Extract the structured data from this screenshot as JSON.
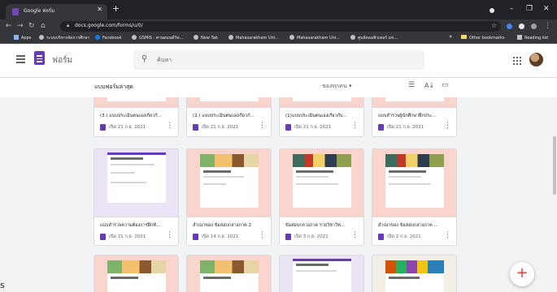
{
  "browser": {
    "tab_title": "Google ฟอร์ม",
    "url": "docs.google.com/forms/u/0/",
    "bookmarks": [
      "Apps",
      "ระบบบริหารจัดการศึกษา",
      "Facebook",
      "GSMIS : ศานตมนต์วิท...",
      "New Tab",
      "Mahasarakham Uni...",
      "Mahasarakham Uni...",
      "ศูนย์คอมพิวเตอร์ มห...",
      "Other bookmarks",
      "Reading list"
    ],
    "overflow_label": "»"
  },
  "app": {
    "name": "ฟอร์ม",
    "search_placeholder": "ค้นหา"
  },
  "section": {
    "title": "แบบฟอร์มล่าสุด",
    "owner_filter": "ของทุกคน"
  },
  "forms": [
    {
      "name": "(3.) แบบประเมินตนเองเกี่ยวกั...",
      "date": "เปิด 21 ก.ย. 2021"
    },
    {
      "name": "(2.) แบบประเมินตนเองเกี่ยวกั...",
      "date": "เปิด 21 ก.ย. 2021"
    },
    {
      "name": "(1)แบบประเมินตนเองเกี่ยวกับ...",
      "date": "เปิด 21 ก.ย. 2021"
    },
    {
      "name": "แบบสำรวจผู้นักศึกษาฝึกประ...",
      "date": "เปิด 21 ก.ย. 2021"
    },
    {
      "name": "แบบสำรวจความต้องการฝึกทั...",
      "date": "เปิด 21 ก.ย. 2021"
    },
    {
      "name": "สำเนาของ ข้อสอบกลางภาค 2",
      "date": "เปิด 14 ก.ย. 2021"
    },
    {
      "name": "ข้อสอบกลางภาค รายวิชาวิท...",
      "date": "เปิด 3 ก.ย. 2021"
    },
    {
      "name": "สำเนาของ ข้อสอบกลางภาค ...",
      "date": "เปิด 2 ก.ย. 2021"
    }
  ],
  "fab_label": "+",
  "stray_text": "s"
}
